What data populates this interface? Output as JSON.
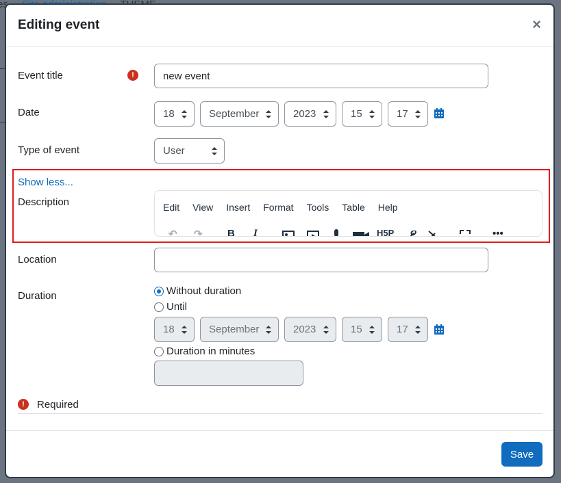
{
  "background": {
    "breadcrumb_partial": "es",
    "breadcrumb_link": "Site administration",
    "breadcrumb_theme": "THEME"
  },
  "modal": {
    "title": "Editing event",
    "close_label": "×"
  },
  "fields": {
    "event_title": {
      "label": "Event title",
      "value": "new event"
    },
    "date": {
      "label": "Date",
      "day": "18",
      "month": "September",
      "year": "2023",
      "hour": "15",
      "minute": "17"
    },
    "type_of_event": {
      "label": "Type of event",
      "value": "User"
    },
    "show_less_link": "Show less...",
    "description": {
      "label": "Description",
      "menu": [
        "Edit",
        "View",
        "Insert",
        "Format",
        "Tools",
        "Table",
        "Help"
      ]
    },
    "location": {
      "label": "Location",
      "value": ""
    },
    "duration": {
      "label": "Duration",
      "option_without": "Without duration",
      "option_until": "Until",
      "option_minutes": "Duration in minutes",
      "selected": "Without duration",
      "until_day": "18",
      "until_month": "September",
      "until_year": "2023",
      "until_hour": "15",
      "until_minute": "17",
      "minutes_value": ""
    }
  },
  "required_note": "Required",
  "save_label": "Save",
  "colors": {
    "accent": "#0f6cbf",
    "required": "#ca3120",
    "highlight": "#e01b1b"
  },
  "icons": [
    "required-icon",
    "calendar-icon",
    "close-icon",
    "undo-icon",
    "redo-icon",
    "bold-icon",
    "italic-icon",
    "image-icon",
    "media-icon",
    "microphone-icon",
    "video-icon",
    "h5p-icon",
    "link-icon",
    "unlink-icon",
    "fullscreen-icon",
    "more-icon"
  ]
}
